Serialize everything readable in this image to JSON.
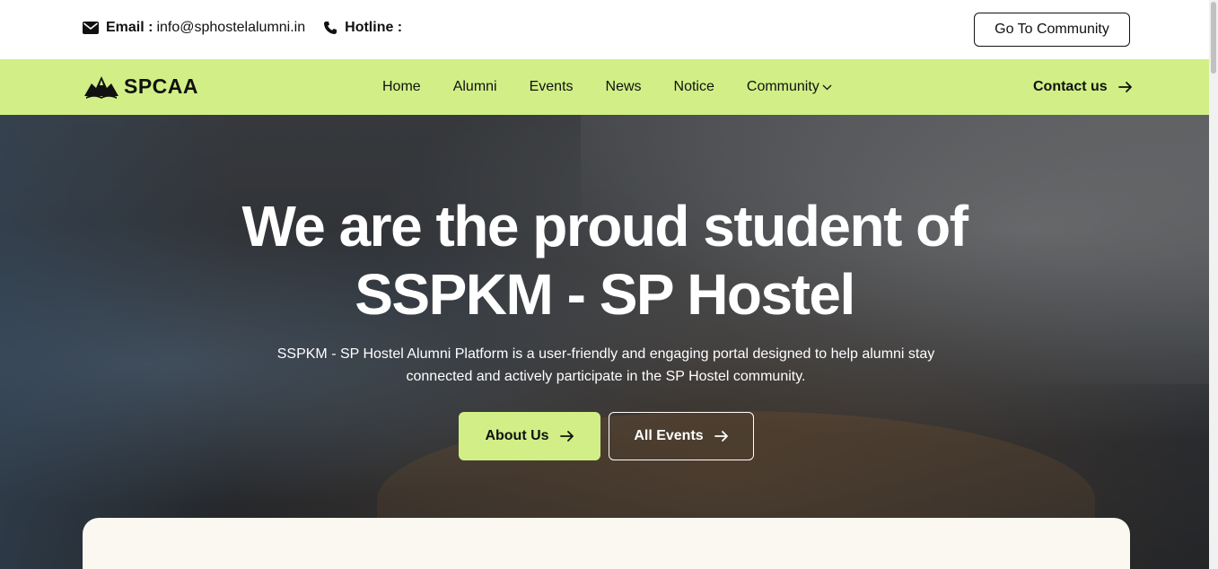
{
  "topbar": {
    "email_label": "Email :",
    "email_value": "info@sphostelalumni.in",
    "hotline_label": "Hotline :",
    "hotline_value": "",
    "community_button": "Go To Community"
  },
  "navbar": {
    "logo_text": "SPCAA",
    "links": [
      "Home",
      "Alumni",
      "Events",
      "News",
      "Notice",
      "Community"
    ],
    "contact_label": "Contact us"
  },
  "hero": {
    "title_line1": "We are the proud student of",
    "title_line2": "SSPKM - SP Hostel",
    "description": "SSPKM - SP Hostel Alumni Platform is a user-friendly and engaging portal designed to help alumni stay connected and actively participate in the SP Hostel community.",
    "primary_button": "About Us",
    "secondary_button": "All Events"
  },
  "colors": {
    "accent": "#d1ef86",
    "text": "#111111",
    "card": "#fbf8f1"
  }
}
